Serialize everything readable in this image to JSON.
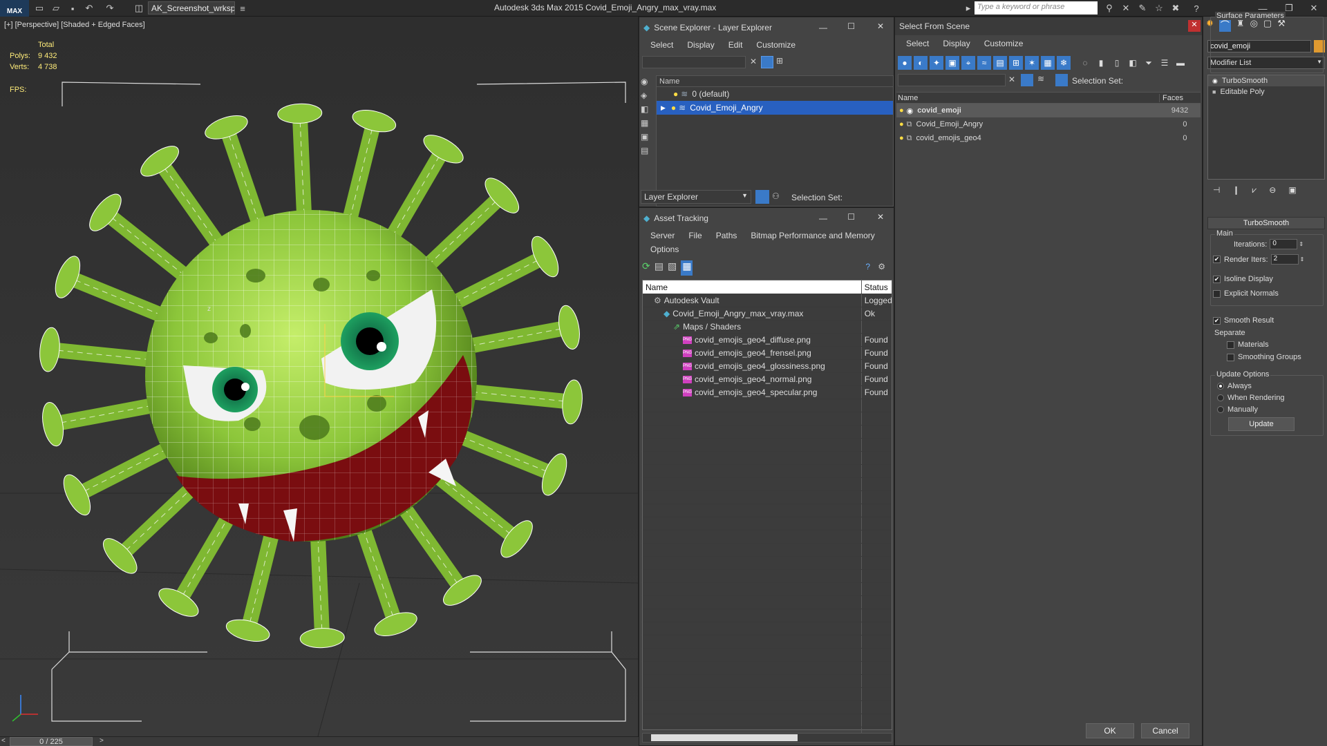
{
  "titlebar": {
    "logo": "MAX",
    "workspace": "AK_Screenshot_wrksp",
    "app_title": "Autodesk 3ds Max  2015     Covid_Emoji_Angry_max_vray.max",
    "search_placeholder": "Type a keyword or phrase"
  },
  "viewport": {
    "label": "[+] [Perspective] [Shaded + Edged Faces]",
    "stats": {
      "total_label": "Total",
      "polys_label": "Polys:",
      "polys_value": "9 432",
      "verts_label": "Verts:",
      "verts_value": "4 738",
      "fps_label": "FPS:"
    },
    "timeline": "0 / 225",
    "axis": {
      "z": "z"
    },
    "colors": {
      "virus_green": "#8cc63a",
      "mouth": "#7a0d10",
      "wire": "#ffffff"
    }
  },
  "scene_explorer": {
    "title": "Scene Explorer - Layer Explorer",
    "menu": [
      "Select",
      "Display",
      "Edit",
      "Customize"
    ],
    "column_name": "Name",
    "layers": [
      "0 (default)",
      "Covid_Emoji_Angry"
    ],
    "footer_dropdown": "Layer Explorer",
    "selection_set_label": "Selection Set:"
  },
  "asset_tracking": {
    "title": "Asset Tracking",
    "menu": [
      "Server",
      "File",
      "Paths",
      "Bitmap Performance and Memory"
    ],
    "menu2": [
      "Options"
    ],
    "col_name": "Name",
    "col_status": "Status",
    "rows": [
      {
        "name": "Autodesk Vault",
        "status": "Logged",
        "indent": 1
      },
      {
        "name": "Covid_Emoji_Angry_max_vray.max",
        "status": "Ok",
        "indent": 2
      },
      {
        "name": "Maps / Shaders",
        "status": "",
        "indent": 3
      },
      {
        "name": "covid_emojis_geo4_diffuse.png",
        "status": "Found",
        "indent": 4
      },
      {
        "name": "covid_emojis_geo4_frensel.png",
        "status": "Found",
        "indent": 4
      },
      {
        "name": "covid_emojis_geo4_glossiness.png",
        "status": "Found",
        "indent": 4
      },
      {
        "name": "covid_emojis_geo4_normal.png",
        "status": "Found",
        "indent": 4
      },
      {
        "name": "covid_emojis_geo4_specular.png",
        "status": "Found",
        "indent": 4
      }
    ]
  },
  "select_from_scene": {
    "title": "Select From Scene",
    "menu": [
      "Select",
      "Display",
      "Customize"
    ],
    "selection_set_label": "Selection Set:",
    "col_name": "Name",
    "col_faces": "Faces",
    "rows": [
      {
        "name": "covid_emoji",
        "faces": "9432",
        "selected": true
      },
      {
        "name": "Covid_Emoji_Angry",
        "faces": "0",
        "selected": false
      },
      {
        "name": "covid_emojis_geo4",
        "faces": "0",
        "selected": false
      }
    ],
    "ok": "OK",
    "cancel": "Cancel"
  },
  "command_panel": {
    "object_name": "covid_emoji",
    "modifier_list": "Modifier List",
    "stack": [
      "TurboSmooth",
      "Editable Poly"
    ],
    "rollout": "TurboSmooth",
    "main_label": "Main",
    "iterations_label": "Iterations:",
    "iterations_value": "0",
    "render_iters_label": "Render Iters:",
    "render_iters_value": "2",
    "isoline_label": "Isoline Display",
    "explicit_normals_label": "Explicit Normals",
    "surface_params_label": "Surface Parameters",
    "smooth_result_label": "Smooth Result",
    "separate_label": "Separate",
    "materials_label": "Materials",
    "smoothing_groups_label": "Smoothing Groups",
    "update_options_label": "Update Options",
    "always_label": "Always",
    "when_rendering_label": "When Rendering",
    "manually_label": "Manually",
    "update_button": "Update"
  }
}
